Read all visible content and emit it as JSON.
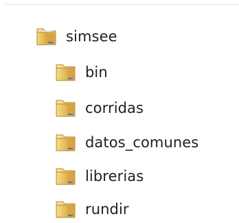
{
  "tree": {
    "root": {
      "label": "simsee",
      "icon": "folder-open-icon"
    },
    "children": [
      {
        "label": "bin",
        "icon": "folder-icon"
      },
      {
        "label": "corridas",
        "icon": "folder-icon"
      },
      {
        "label": "datos_comunes",
        "icon": "folder-icon"
      },
      {
        "label": "librerias",
        "icon": "folder-icon"
      },
      {
        "label": "rundir",
        "icon": "folder-icon"
      }
    ]
  },
  "colors": {
    "background": "#ffffff",
    "text": "#1e1e1e",
    "folder_light": "#f4dc7a",
    "folder_dark": "#d8a13a",
    "folder_edge": "#b7852b",
    "doc_blue": "#4a79c8"
  }
}
